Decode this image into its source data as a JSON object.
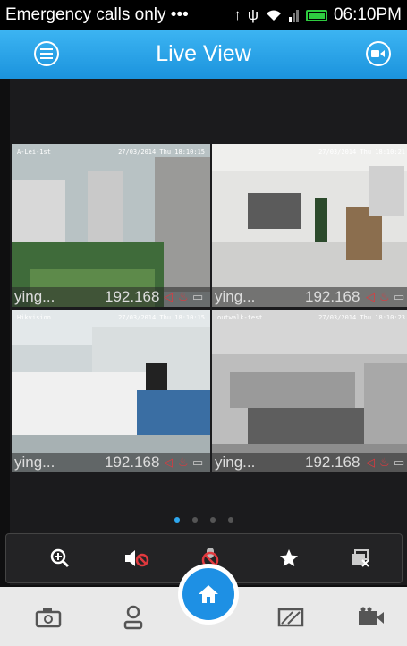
{
  "status_bar": {
    "carrier": "Emergency calls only •••",
    "time": "06:10PM"
  },
  "header": {
    "title": "Live View"
  },
  "cameras": [
    {
      "name": "ying...",
      "ip": "192.168",
      "overlay_name": "A-Lei-1st",
      "timestamp": "27/03/2014 Thu 18:10:15",
      "selected": true
    },
    {
      "name": "ying...",
      "ip": "192.168",
      "overlay_name": "",
      "timestamp": "27/03/2014 Thu 18:10:21",
      "selected": false
    },
    {
      "name": "ying...",
      "ip": "192.168",
      "overlay_name": "Hikvision",
      "timestamp": "27/03/2014 Thu 18:10:15",
      "selected": false
    },
    {
      "name": "ying...",
      "ip": "192.168",
      "overlay_name": "outwalk-test",
      "timestamp": "27/03/2014 Thu 18:10:23",
      "selected": false
    }
  ],
  "page_indicator": {
    "count": 4,
    "active": 0
  },
  "toolbar": {
    "items": [
      "zoom-in-icon",
      "sound-muted-icon",
      "microphone-off-icon",
      "star-icon",
      "close-all-icon"
    ]
  },
  "bottom_nav": {
    "items": [
      "capture-icon",
      "person-icon",
      "home-icon",
      "picture-icon",
      "video-camera-icon"
    ]
  },
  "colors": {
    "header": "#2ea7ee",
    "accent": "#1e90e4",
    "alert": "#e0393e"
  }
}
